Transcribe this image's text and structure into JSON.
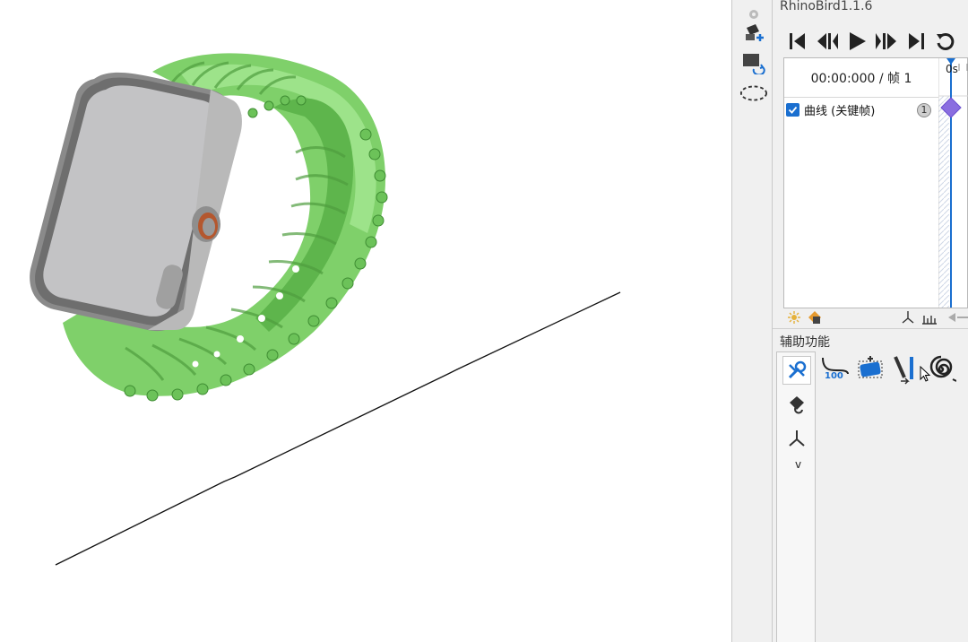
{
  "plugin": {
    "title": "RhinoBird1.1.6",
    "timecode": "00:00:000 / 帧 1",
    "ruler_label": "0s",
    "tracks": [
      {
        "label": "曲线 (关键帧)",
        "checked": true,
        "badge": "1"
      }
    ]
  },
  "transport": [
    "go-to-start-icon",
    "step-back-icon",
    "play-icon",
    "step-forward-icon",
    "go-to-end-icon",
    "loop-icon"
  ],
  "aux_section": {
    "title": "辅助功能",
    "more": "v",
    "tool_100_label": "100"
  },
  "colors": {
    "accent": "#1a6fd0",
    "keyframe": "#8a6ee0",
    "band": "#7fd06a",
    "panel_bg": "#f0f0f0"
  }
}
